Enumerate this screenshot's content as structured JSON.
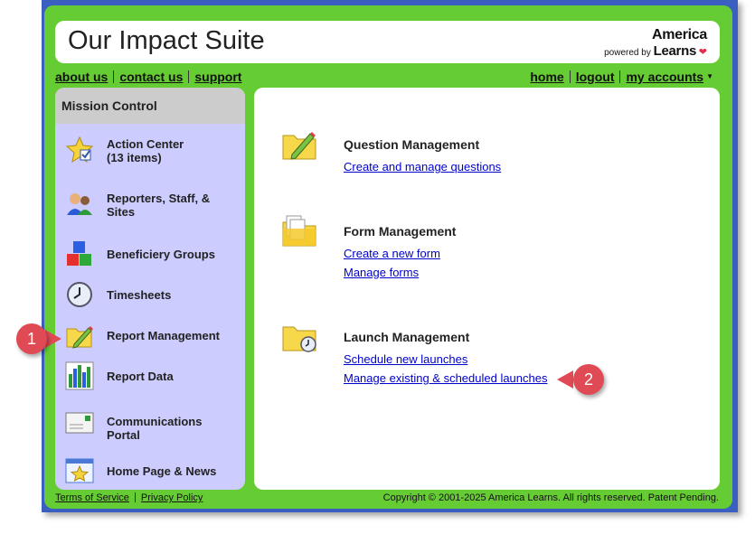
{
  "app": {
    "title": "Our Impact Suite",
    "logo_line1": "America",
    "logo_powered": "powered by",
    "logo_line2": "Learns"
  },
  "toplinks_left": [
    "about us",
    "contact us",
    "support"
  ],
  "toplinks_right": [
    "home",
    "logout",
    "my accounts"
  ],
  "sidebar": {
    "header": "Mission Control",
    "items": [
      {
        "label": "Action Center\n(13 items)",
        "icon": "star-checkbox-icon"
      },
      {
        "label": "Reporters, Staff, &\nSites",
        "icon": "people-icon"
      },
      {
        "label": "Beneficiery Groups",
        "icon": "blocks-icon"
      },
      {
        "label": "Timesheets",
        "icon": "clock-icon"
      },
      {
        "label": "Report Management",
        "icon": "folder-pencil-icon"
      },
      {
        "label": "Report Data",
        "icon": "bar-chart-icon"
      },
      {
        "label": "Communications\nPortal",
        "icon": "envelope-icon"
      },
      {
        "label": "Home Page & News",
        "icon": "star-window-icon"
      }
    ]
  },
  "main": {
    "question": {
      "title": "Question Management",
      "links": [
        "Create and manage questions"
      ]
    },
    "form": {
      "title": "Form Management",
      "links": [
        "Create a new form",
        "Manage forms"
      ]
    },
    "launch": {
      "title": "Launch Management",
      "links": [
        "Schedule new launches",
        "Manage existing & scheduled launches"
      ]
    }
  },
  "footer": {
    "terms": "Terms of Service",
    "privacy": "Privacy Policy",
    "copyright": "Copyright © 2001-2025 America Learns. All rights reserved. Patent Pending."
  },
  "callouts": [
    "1",
    "2"
  ],
  "colors": {
    "green": "#66cc33",
    "frame": "#3b5fc0",
    "sidebar": "#ccccff",
    "link": "#0000cc",
    "callout": "#e04a55"
  }
}
